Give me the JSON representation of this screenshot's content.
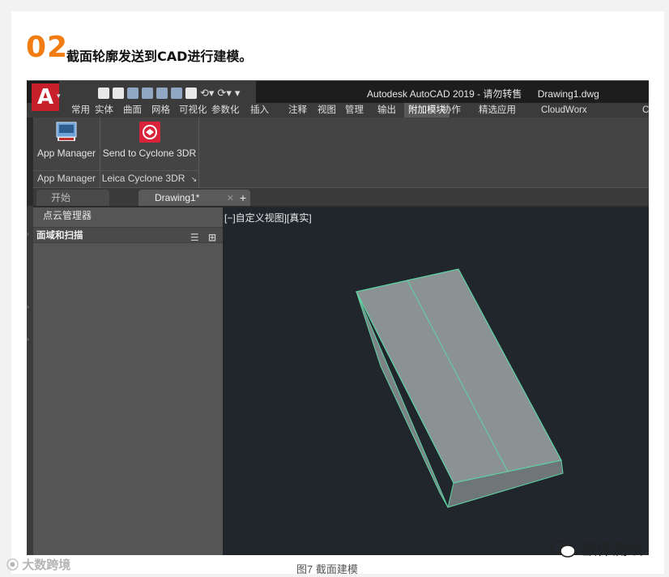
{
  "section": {
    "number": "02",
    "title": "截面轮廓发送到CAD进行建模。"
  },
  "app": {
    "logo_letter": "A",
    "title": "Autodesk AutoCAD 2019 - 请勿转售",
    "document": "Drawing1.dwg",
    "brand_color": "#c8202a"
  },
  "ribbon_tabs": [
    "常用",
    "实体",
    "曲面",
    "网格",
    "可视化",
    "参数化",
    "插入",
    "注释",
    "视图",
    "管理",
    "输出",
    "附加模块",
    "协作",
    "精选应用",
    "CloudWorx",
    "C("
  ],
  "active_ribbon_tab": "附加模块",
  "ribbon": {
    "panels": [
      {
        "button_label": "App Manager",
        "panel_label": "App Manager",
        "icon": "app-manager-icon"
      },
      {
        "button_label": "Send to Cyclone 3DR",
        "panel_label": "Leica Cyclone 3DR",
        "icon": "cyclone-icon"
      }
    ],
    "panel_expand_glyph": "↘"
  },
  "doc_tabs": {
    "start": "开始",
    "drawing": "Drawing1*",
    "close_glyph": "✕",
    "new_glyph": "+"
  },
  "palette": {
    "header": "点云管理器",
    "section": "面域和扫描"
  },
  "viewport": {
    "label": "[−]自定义视图][真实]",
    "model_fill": "#8a9294",
    "edge_color": "#5fd4a4"
  },
  "watermark": {
    "text": "欧徕测绘"
  },
  "bottom_logo": {
    "text": "大数跨境"
  },
  "caption": "图7  截面建模"
}
